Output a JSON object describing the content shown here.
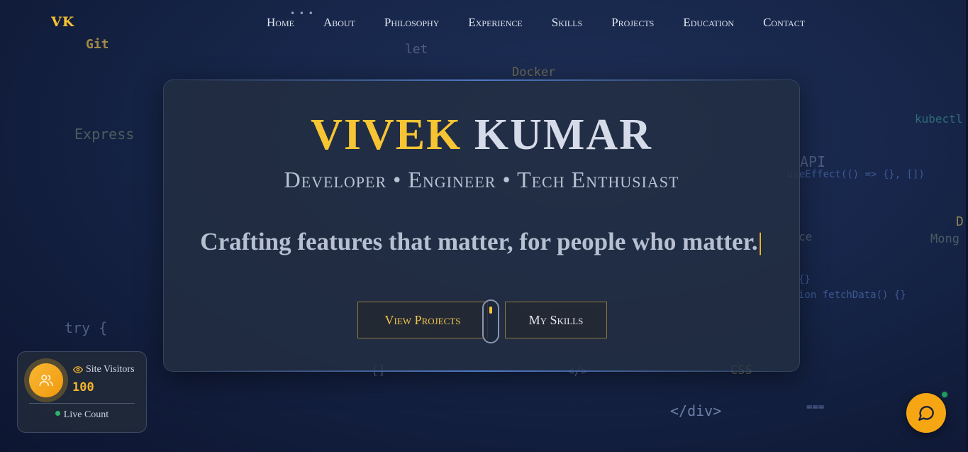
{
  "brand": {
    "logo": "VK"
  },
  "nav": {
    "items": [
      "Home",
      "About",
      "Philosophy",
      "Experience",
      "Skills",
      "Projects",
      "Education",
      "Contact"
    ],
    "dots": "• • •"
  },
  "background_code": [
    {
      "text": "Git"
    },
    {
      "text": "let"
    },
    {
      "text": "Docker"
    },
    {
      "text": "Express"
    },
    {
      "text": "kubectl"
    },
    {
      "text": "API"
    },
    {
      "text": "useEffect(() => {}, [])"
    },
    {
      "text": "D"
    },
    {
      "text": "Mong"
    },
    {
      "text": "ce"
    },
    {
      "text": "{}"
    },
    {
      "text": "ion fetchData() {}"
    },
    {
      "text": "try {"
    },
    {
      "text": "</div>"
    },
    {
      "text": "==="
    },
    {
      "text": "CSS"
    },
    {
      "text": "</>"
    },
    {
      "text": "[]"
    }
  ],
  "hero": {
    "first_name": "VIVEK",
    "last_name": "KUMAR",
    "subtitle": "Developer • Engineer • Tech Enthusiast",
    "tagline": "Crafting features that matter, for people who matter.",
    "caret": "|",
    "buttons": {
      "projects": "View Projects",
      "skills": "My Skills"
    }
  },
  "visitor_widget": {
    "label": "Site Visitors",
    "count": "100",
    "live": "Live Count",
    "icon": "users-icon"
  },
  "chat": {
    "icon": "chat-bubble-icon"
  },
  "colors": {
    "accent": "#f5c231",
    "background": "#17264a",
    "card": "#232e42",
    "live_dot": "#2fb46b"
  }
}
